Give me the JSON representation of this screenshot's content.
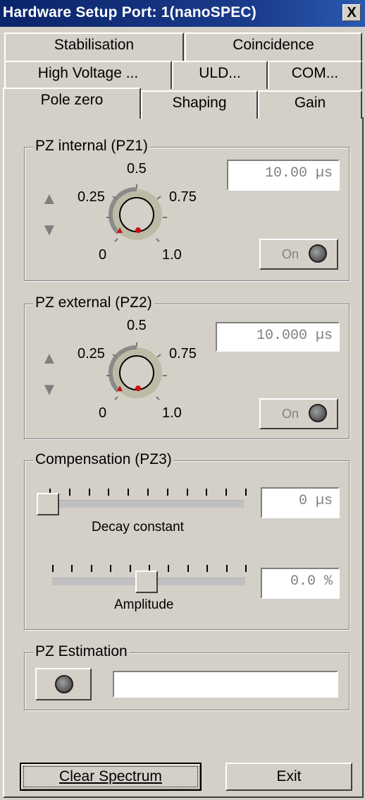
{
  "window": {
    "title": "Hardware Setup Port: 1(nanoSPEC)",
    "close_label": "X"
  },
  "tabs": {
    "row1": [
      "Stabilisation",
      "Coincidence"
    ],
    "row2": [
      "High Voltage ...",
      "ULD...",
      "COM..."
    ],
    "row3": [
      "Pole zero",
      "Shaping",
      "Gain"
    ],
    "active": "Pole zero"
  },
  "pz1": {
    "label": "PZ internal (PZ1)",
    "value": "10.00 µs",
    "dial": {
      "tick_0": "0",
      "tick_025": "0.25",
      "tick_05": "0.5",
      "tick_075": "0.75",
      "tick_1": "1.0"
    },
    "on_label": "On"
  },
  "pz2": {
    "label": "PZ external (PZ2)",
    "value": "10.000 µs",
    "dial": {
      "tick_0": "0",
      "tick_025": "0.25",
      "tick_05": "0.5",
      "tick_075": "0.75",
      "tick_1": "1.0"
    },
    "on_label": "On"
  },
  "pz3": {
    "label": "Compensation (PZ3)",
    "decay": {
      "label": "Decay constant",
      "value": "0 µs",
      "position": 0.0
    },
    "amplitude": {
      "label": "Amplitude",
      "value": "0.0 %",
      "position": 0.5
    }
  },
  "estimation": {
    "label": "PZ Estimation",
    "value": ""
  },
  "buttons": {
    "clear": "Clear Spectrum",
    "exit": "Exit"
  },
  "colors": {
    "title_bg": "#0a246a",
    "face": "#d4d0c8",
    "marker_red": "#cc1010"
  }
}
